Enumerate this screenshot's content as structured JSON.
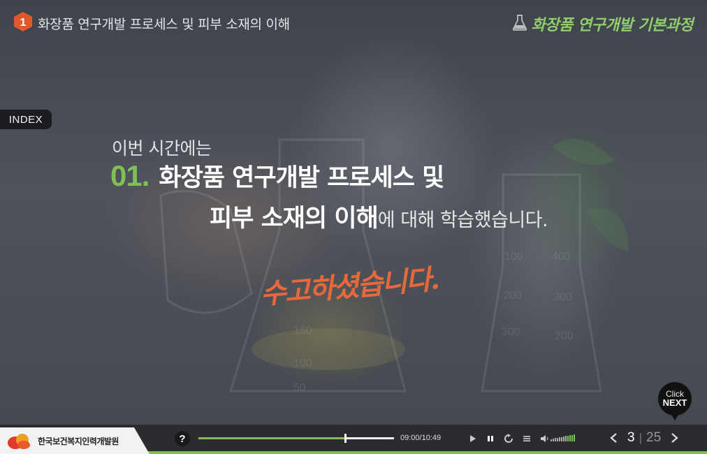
{
  "header": {
    "chapter_number": "1",
    "chapter_title": "화장품 연구개발 프로세스 및 피부 소재의 이해",
    "course_title": "화장품 연구개발 기본과정"
  },
  "sidebar": {
    "index_label": "INDEX"
  },
  "main": {
    "intro": "이번 시간에는",
    "lesson_number": "01",
    "title_line1": "화장품 연구개발 프로세스 및",
    "title_line2": "피부 소재의 이해",
    "title_tail": "에 대해 학습했습니다.",
    "thanks": "수고하셨습니다."
  },
  "click_next": {
    "line1": "Click",
    "line2": "NEXT"
  },
  "footer": {
    "org_name": "한국보건복지인력개발원",
    "help_label": "?",
    "time": "09:00/10:49",
    "progress_fraction": 0.75,
    "volume_level_fraction": 0.35,
    "page_current": "3",
    "page_total": "25"
  },
  "colors": {
    "accent_green": "#7fbf55",
    "thanks_orange": "#e8683c",
    "chapter_badge": "#e2572b"
  },
  "icons": [
    "chapter-badge-icon",
    "flask-icon",
    "help-icon",
    "play-icon",
    "pause-icon",
    "replay-icon",
    "menu-icon",
    "volume-icon",
    "prev-page-icon",
    "next-page-icon"
  ]
}
